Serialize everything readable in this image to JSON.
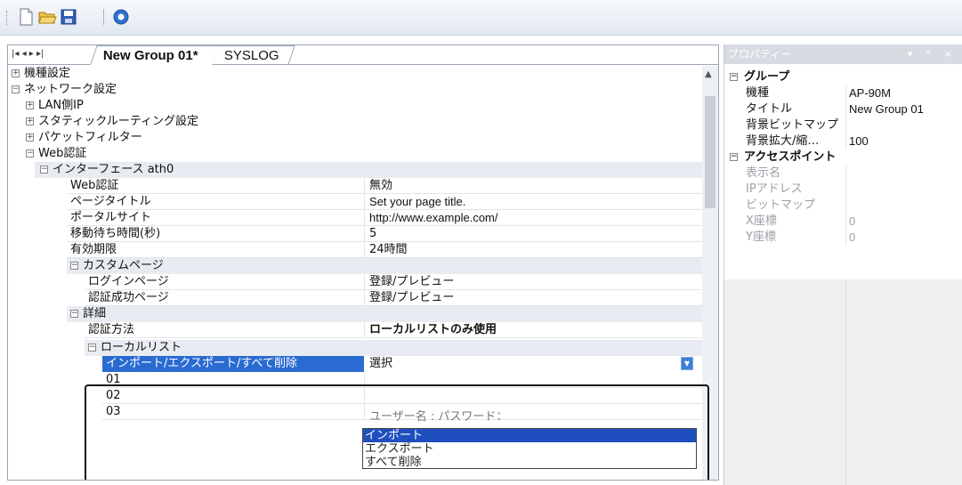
{
  "toolbar": {
    "icons": [
      "new-file-icon",
      "open-folder-icon",
      "save-icon",
      "help-icon"
    ]
  },
  "tabs": {
    "nav_symbols": "|◂  ◂  ▸  ▸|",
    "active": "New Group 01*",
    "other": "SYSLOG"
  },
  "tree": {
    "model_settings": "機種設定",
    "network_settings": "ネットワーク設定",
    "lan_ip": "LAN側IP",
    "static_routing": "スタティックルーティング設定",
    "packet_filter": "パケットフィルター",
    "web_auth": "Web認証",
    "interface": "インターフェース ath0",
    "rows": [
      {
        "label": "Web認証",
        "value": "無効"
      },
      {
        "label": "ページタイトル",
        "value": "Set your page title."
      },
      {
        "label": "ポータルサイト",
        "value": "http://www.example.com/"
      },
      {
        "label": "移動待ち時間(秒)",
        "value": "5"
      },
      {
        "label": "有効期限",
        "value": "24時間"
      }
    ],
    "custom_page": "カスタムページ",
    "custom_rows": [
      {
        "label": "ログインページ",
        "value": "登録/プレビュー"
      },
      {
        "label": "認証成功ページ",
        "value": "登録/プレビュー"
      }
    ],
    "details": "詳細",
    "auth_method": {
      "label": "認証方法",
      "value": "ローカルリストのみ使用"
    },
    "local_list": "ローカルリスト",
    "import_row": {
      "label": "インポート/エクスポート/すべて削除",
      "value": "選択"
    },
    "entries": [
      "01",
      "02",
      "03"
    ],
    "dropdown_options": [
      "インポート",
      "エクスポート",
      "すべて削除"
    ],
    "partial_text": "ユーザー名 : パスワード："
  },
  "properties": {
    "title": "プロパティー",
    "title_tools": "▾ ᵠ ×",
    "group": "グループ",
    "group_rows": [
      {
        "key": "機種",
        "value": "AP-90M"
      },
      {
        "key": "タイトル",
        "value": "New Group 01"
      },
      {
        "key": "背景ビットマップ",
        "value": ""
      },
      {
        "key": "背景拡大/縮…",
        "value": "100"
      }
    ],
    "access_point": "アクセスポイント",
    "ap_rows": [
      {
        "key": "表示名",
        "value": ""
      },
      {
        "key": "IPアドレス",
        "value": ""
      },
      {
        "key": "ビットマップ",
        "value": ""
      },
      {
        "key": "X座標",
        "value": "0"
      },
      {
        "key": "Y座標",
        "value": "0"
      }
    ]
  }
}
